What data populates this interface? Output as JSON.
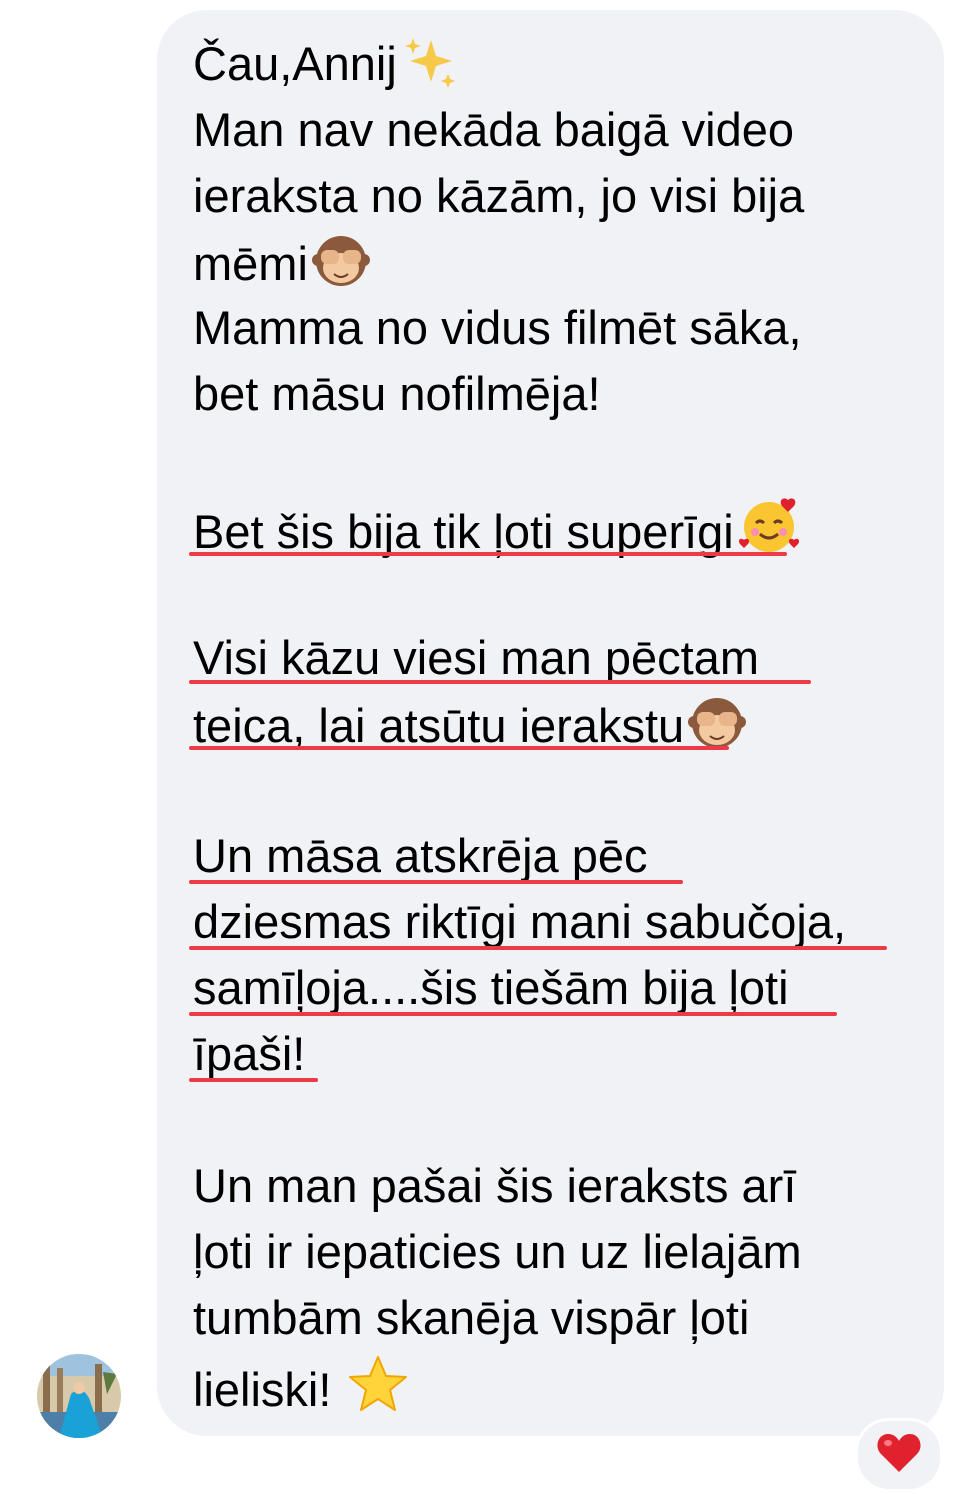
{
  "message": {
    "lines": [
      "Čau,Annij",
      "Man nav nekāda baigā video",
      "ieraksta no kāzām, jo visi bija",
      "mēmi",
      "Mamma no vidus filmēt sāka,",
      "bet māsu nofilmēja!",
      "Bet šis bija tik ļoti superīgi",
      "Visi kāzu viesi man pēctam",
      "teica, lai atsūtu ierakstu",
      "Un māsa atskrēja pēc",
      "dziesmas riktīgi mani sabučoja,",
      "samīļoja....šis tiešām bija ļoti",
      "īpaši!",
      "Un man pašai šis ieraksts arī",
      "ļoti ir iepaticies un uz lielajām",
      "tumbām skanēja vispār ļoti",
      "lieliski!"
    ],
    "emojis": [
      "sparkles-emoji",
      "see-no-evil-monkey-emoji",
      "smiling-face-with-hearts-emoji",
      "see-no-evil-monkey-emoji",
      "star-emoji"
    ],
    "highlight_color": "#ec3b45",
    "bubble_color": "#f1f2f6"
  },
  "reaction": {
    "icon": "heart-icon",
    "color": "#e0212e"
  }
}
